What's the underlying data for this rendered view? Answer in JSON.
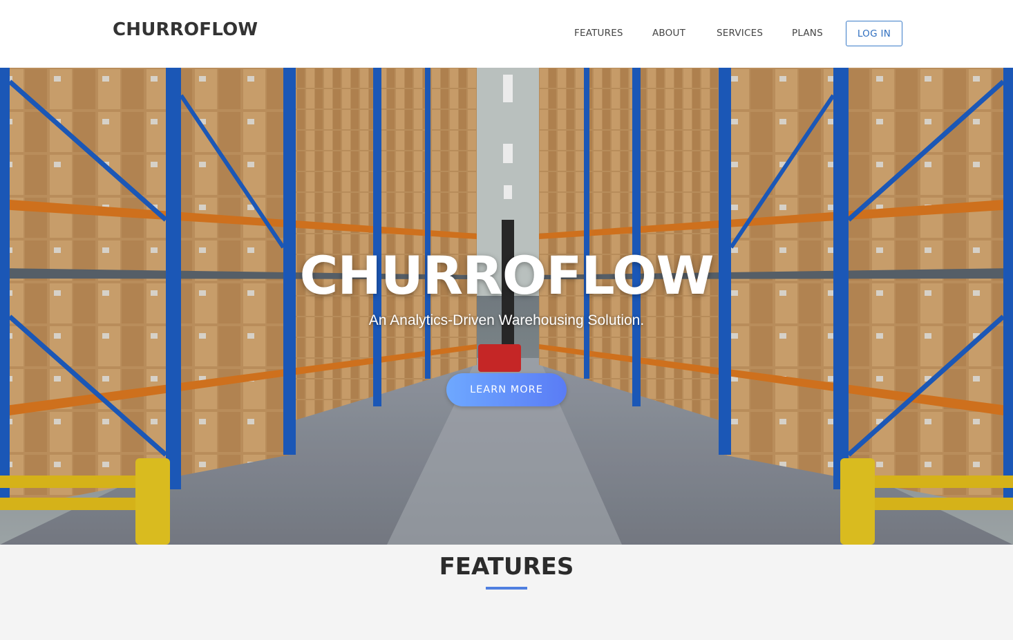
{
  "navbar": {
    "brand": "CHURROFLOW",
    "links": [
      {
        "label": "FEATURES"
      },
      {
        "label": "ABOUT"
      },
      {
        "label": "SERVICES"
      },
      {
        "label": "PLANS"
      }
    ],
    "login_label": "LOG IN",
    "login_color": "#2f6fc0"
  },
  "hero": {
    "title": "CHURROFLOW",
    "subtitle": "An Analytics-Driven Warehousing Solution.",
    "cta_label": "LEARN MORE",
    "cta_gradient": [
      "#6ea8ff",
      "#5a7cf5"
    ],
    "background_image": "warehouse-aisle-photo"
  },
  "features": {
    "heading": "FEATURES",
    "accent": "#4f7fe0"
  }
}
